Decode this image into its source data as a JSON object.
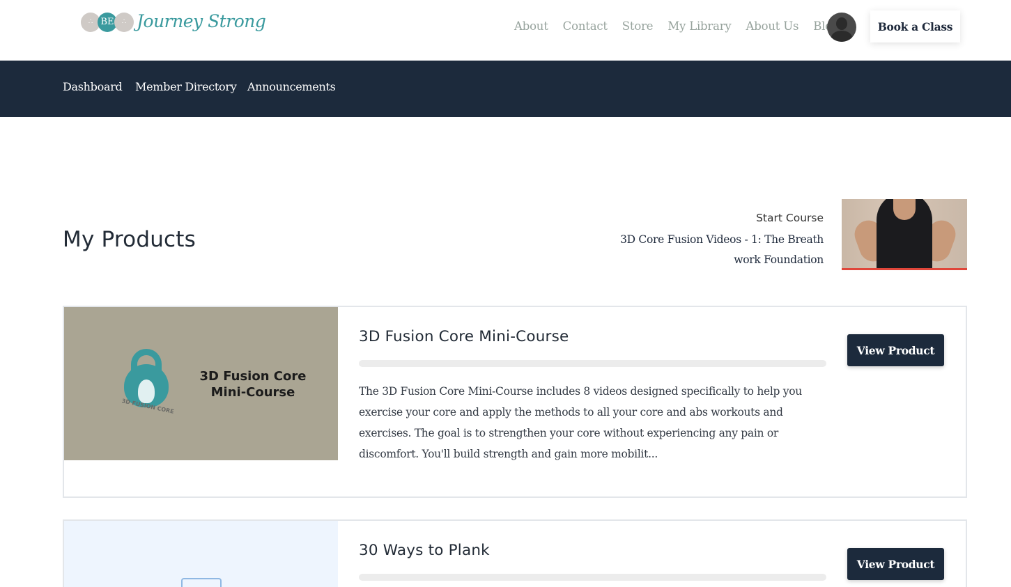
{
  "header": {
    "logo": {
      "circle_left": "∴",
      "circle_center": "BE",
      "circle_right": "∴",
      "script_text": "Journey Strong"
    },
    "nav": [
      "About",
      "Contact",
      "Store",
      "My Library",
      "About Us",
      "Blog"
    ],
    "avatar_icon": "user-avatar",
    "book_button": "Book a Class"
  },
  "member_nav": {
    "items": [
      "Dashboard",
      "Member Directory",
      "Announcements"
    ]
  },
  "main": {
    "title": "My Products",
    "start_course": {
      "label": "Start Course",
      "lesson_line1": "3D Core Fusion Videos - 1: The Breath",
      "lesson_line2": "work Foundation"
    }
  },
  "products": [
    {
      "title": "3D Fusion Core Mini-Course",
      "image_title_line1": "3D Fusion Core",
      "image_title_line2": "Mini-Course",
      "image_caption": "3D FUSION CORE",
      "progress": 0,
      "description": "The 3D Fusion Core Mini-Course includes 8 videos designed specifically to help you exercise your core and apply the methods to all your core and abs workouts and exercises. The goal is to strengthen your core without experiencing any pain or discomfort. You'll build strength and gain more mobilit...",
      "button": "View Product"
    },
    {
      "title": "30 Ways to Plank",
      "progress": 0,
      "button": "View Product"
    }
  ],
  "colors": {
    "brand_teal": "#3a9a9e",
    "navy": "#1c2a3c",
    "nav_gray": "#97a39d"
  }
}
